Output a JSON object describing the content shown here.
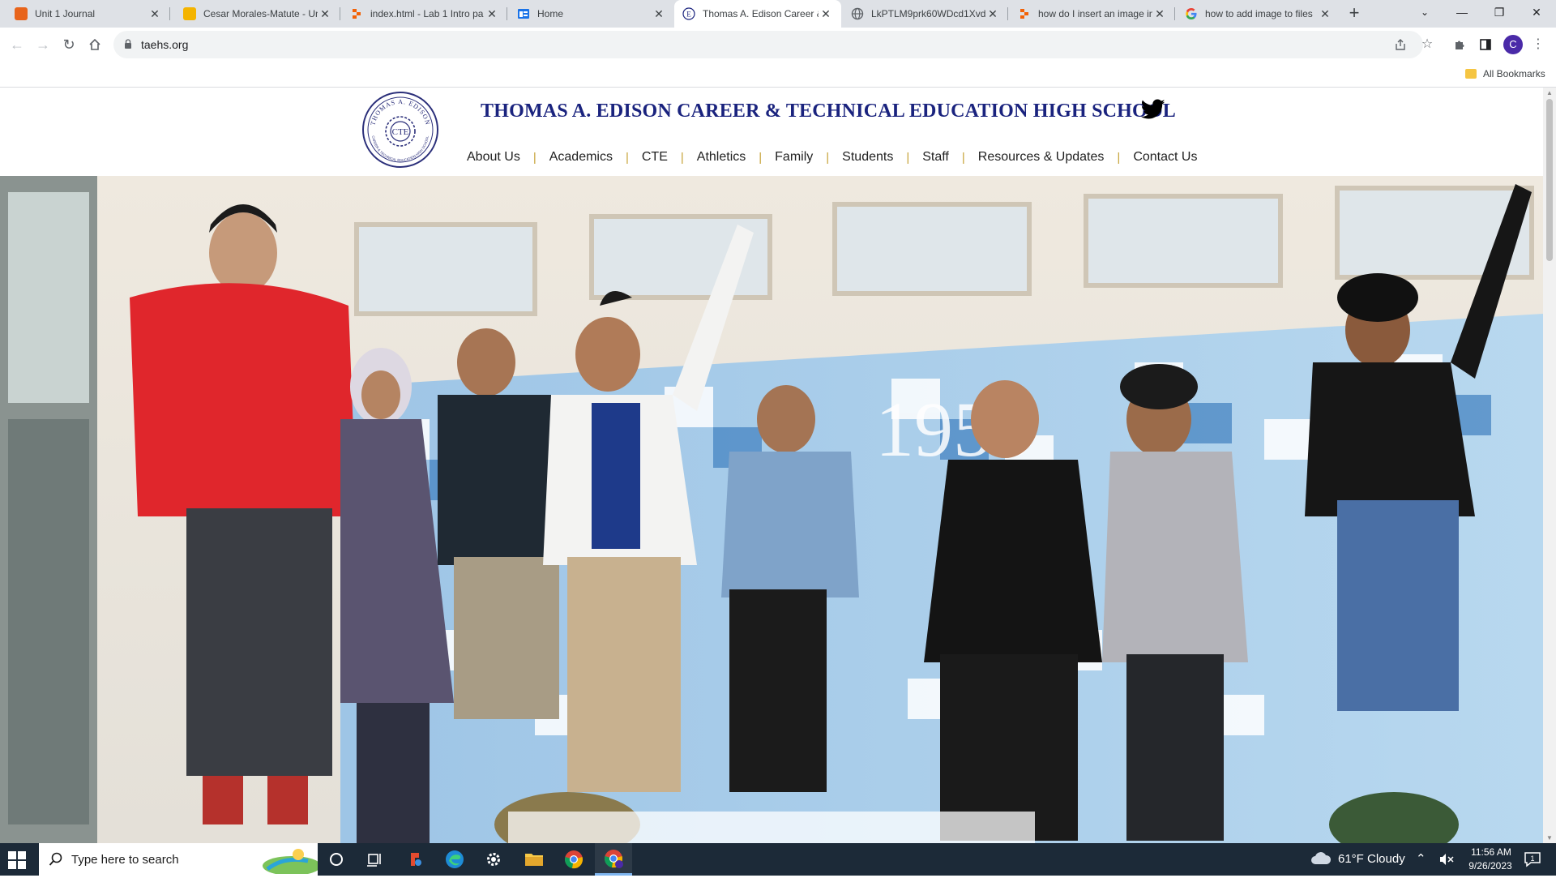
{
  "browser": {
    "tabs": [
      {
        "title": "Unit 1 Journal",
        "favicon": "schoology-icon",
        "color": "#e8641b"
      },
      {
        "title": "Cesar Morales-Matute - Un",
        "favicon": "slides-icon",
        "color": "#f4b400"
      },
      {
        "title": "index.html - Lab 1 Intro pa",
        "favicon": "replit-icon",
        "color": "#f26207"
      },
      {
        "title": "Home",
        "favicon": "sites-icon",
        "color": "#1a73e8"
      },
      {
        "title": "Thomas A. Edison Career &",
        "favicon": "edison-icon",
        "color": "#1a237e",
        "active": true
      },
      {
        "title": "LkPTLM9prk60WDcd1Xvd\\",
        "favicon": "globe-icon",
        "color": "#5f6368"
      },
      {
        "title": "how do I insert an image in",
        "favicon": "replit-icon",
        "color": "#f26207"
      },
      {
        "title": "how to add image to files",
        "favicon": "google-icon",
        "color": "#4285f4"
      }
    ],
    "url": "taehs.org",
    "bookmarks_label": "All Bookmarks",
    "profile_initial": "C"
  },
  "site": {
    "title": "THOMAS A. EDISON CAREER & TECHNICAL EDUCATION HIGH SCHOOL",
    "logo": {
      "ring_text": "THOMAS A. EDISON",
      "ring_text_bottom": "CAREER & TECHNICAL EDUCATION HIGH SCHOOL",
      "center": "CTE"
    },
    "nav": [
      "About Us",
      "Academics",
      "CTE",
      "Athletics",
      "Family",
      "Students",
      "Staff",
      "Resources & Updates",
      "Contact Us"
    ],
    "hero": {
      "building_year": "1958"
    }
  },
  "taskbar": {
    "search_placeholder": "Type here to search",
    "weather": "61°F  Cloudy",
    "time": "11:56 AM",
    "date": "9/26/2023",
    "notifications": "1"
  }
}
